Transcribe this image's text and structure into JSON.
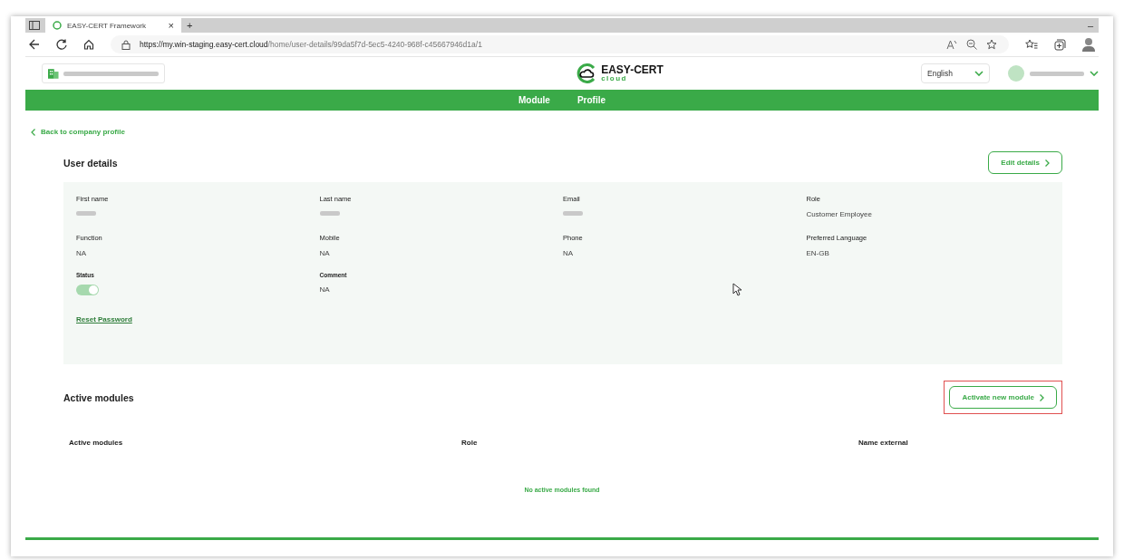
{
  "browser": {
    "tab_title": "EASY-CERT Framework",
    "tab_close": "×",
    "new_tab": "+",
    "minimize": "–",
    "url_host": "https://my.win-staging.easy-cert.cloud",
    "url_path": "/home/user-details/99da5f7d-5ec5-4240-968f-c45667946d1a/1"
  },
  "header": {
    "logo_title": "EASY-CERT",
    "logo_sub": "cloud",
    "language": "English"
  },
  "nav": [
    {
      "label": "Module",
      "selected": false
    },
    {
      "label": "Profile",
      "selected": false
    }
  ],
  "back_link": "Back to company profile",
  "user_details": {
    "title": "User details",
    "edit_button": "Edit details",
    "fields": [
      {
        "label": "First name",
        "kind": "redacted"
      },
      {
        "label": "Last name",
        "kind": "redacted"
      },
      {
        "label": "Email",
        "kind": "redacted"
      },
      {
        "label": "Role",
        "kind": "text",
        "value": "Customer Employee"
      },
      {
        "label": "Function",
        "kind": "text",
        "value": "NA"
      },
      {
        "label": "Mobile",
        "kind": "text",
        "value": "NA"
      },
      {
        "label": "Phone",
        "kind": "text",
        "value": "NA"
      },
      {
        "label": "Preferred Language",
        "kind": "text",
        "value": "EN-GB"
      },
      {
        "label": "Status",
        "kind": "toggle",
        "on": true
      },
      {
        "label": "Comment",
        "kind": "text",
        "value": "NA"
      }
    ],
    "reset_link": "Reset Password"
  },
  "active_modules": {
    "title": "Active modules",
    "activate_button": "Activate new module",
    "activate_highlighted": true,
    "columns": [
      "Active modules",
      "Role",
      "Name external"
    ],
    "empty_message": "No active modules found"
  }
}
